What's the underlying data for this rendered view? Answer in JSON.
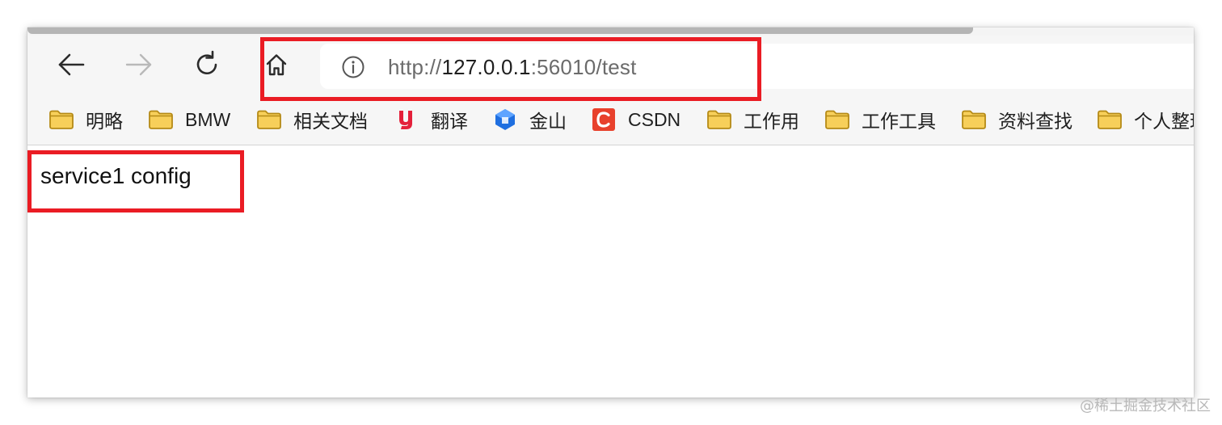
{
  "browser": {
    "toolbar": {
      "back": {
        "icon": "arrow-left-icon",
        "enabled": true
      },
      "forward": {
        "icon": "arrow-right-icon",
        "enabled": false
      },
      "reload": {
        "icon": "reload-icon"
      },
      "home": {
        "icon": "home-icon"
      }
    },
    "address_bar": {
      "icon": "info-icon",
      "url_prefix": "http://",
      "url_host": "127.0.0.1",
      "url_suffix": ":56010/test"
    },
    "bookmarks": [
      {
        "label": "明略",
        "icon": "folder-icon"
      },
      {
        "label": "BMW",
        "icon": "folder-icon"
      },
      {
        "label": "相关文档",
        "icon": "folder-icon"
      },
      {
        "label": "翻译",
        "icon": "youdao-icon"
      },
      {
        "label": "金山",
        "icon": "kingsoft-icon"
      },
      {
        "label": "CSDN",
        "icon": "csdn-icon"
      },
      {
        "label": "工作用",
        "icon": "folder-icon"
      },
      {
        "label": "工作工具",
        "icon": "folder-icon"
      },
      {
        "label": "资料查找",
        "icon": "folder-icon"
      },
      {
        "label": "个人整理",
        "icon": "folder-icon"
      }
    ]
  },
  "page": {
    "body_text": "service1 config"
  },
  "watermark": "@稀土掘金技术社区",
  "colors": {
    "highlight": "#ea1c24",
    "folder_fill": "#f7cf5a",
    "folder_stroke": "#b58a16",
    "csdn": "#e8412c",
    "youdao": "#e4203a",
    "kingsoft": "#1f6fe0"
  }
}
